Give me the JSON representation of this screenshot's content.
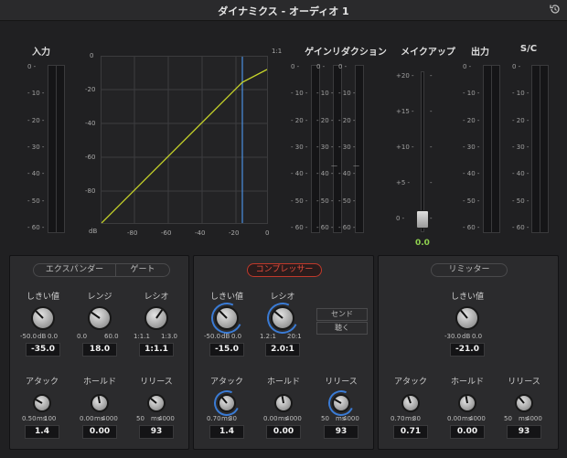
{
  "window": {
    "title": "ダイナミクス - オーディオ 1"
  },
  "headers": {
    "input": "入力",
    "gain_reduction": "ゲインリダクション",
    "makeup": "メイクアップ",
    "output": "出力",
    "sidechain": "S/C"
  },
  "meter_ticks": [
    "0",
    "10",
    "20",
    "30",
    "40",
    "50",
    "60"
  ],
  "makeup_ticks": [
    "+20",
    "+15",
    "+10",
    "+5",
    "0"
  ],
  "makeup_value": "0.0",
  "graph": {
    "ratio_label": "1:1",
    "y_ticks": [
      "0",
      "-20",
      "-40",
      "-60",
      "-80"
    ],
    "x_ticks": [
      "dB",
      "-80",
      "-60",
      "-40",
      "-20",
      "0"
    ]
  },
  "panels": {
    "expander": {
      "tab1": "エクスパンダー",
      "tab2": "ゲート",
      "threshold": {
        "label": "しきい値",
        "min": "-50.0",
        "unit": "dB",
        "max": "0.0",
        "value": "-35.0"
      },
      "range": {
        "label": "レンジ",
        "min": "0.0",
        "max": "60.0",
        "value": "18.0"
      },
      "ratio": {
        "label": "レシオ",
        "min": "1:1.1",
        "max": "1:3.0",
        "value": "1:1.1"
      },
      "attack": {
        "label": "アタック",
        "min": "0.50",
        "unit": "ms",
        "max": "100",
        "value": "1.4"
      },
      "hold": {
        "label": "ホールド",
        "min": "0.00",
        "unit": "ms",
        "max": "4000",
        "value": "0.00"
      },
      "release": {
        "label": "リリース",
        "min": "50",
        "unit": "ms",
        "max": "4000",
        "value": "93"
      }
    },
    "compressor": {
      "title": "コンプレッサー",
      "threshold": {
        "label": "しきい値",
        "min": "-50.0",
        "unit": "dB",
        "max": "0.0",
        "value": "-15.0"
      },
      "ratio": {
        "label": "レシオ",
        "min": "1.2:1",
        "max": "20:1",
        "value": "2.0:1"
      },
      "send": "センド",
      "listen": "聴く",
      "attack": {
        "label": "アタック",
        "min": "0.70",
        "unit": "ms",
        "max": "30",
        "value": "1.4"
      },
      "hold": {
        "label": "ホールド",
        "min": "0.00",
        "unit": "ms",
        "max": "4000",
        "value": "0.00"
      },
      "release": {
        "label": "リリース",
        "min": "50",
        "unit": "ms",
        "max": "4000",
        "value": "93"
      }
    },
    "limiter": {
      "title": "リミッター",
      "threshold": {
        "label": "しきい値",
        "min": "-30.0",
        "unit": "dB",
        "max": "0.0",
        "value": "-21.0"
      },
      "attack": {
        "label": "アタック",
        "min": "0.70",
        "unit": "ms",
        "max": "30",
        "value": "0.71"
      },
      "hold": {
        "label": "ホールド",
        "min": "0.00",
        "unit": "ms",
        "max": "4000",
        "value": "0.00"
      },
      "release": {
        "label": "リリース",
        "min": "50",
        "unit": "ms",
        "max": "4000",
        "value": "93"
      }
    }
  },
  "colors": {
    "curve": "#c8d62a",
    "threshold_line": "#4a90e2",
    "accent_red": "#e74c3c",
    "value_green": "#8fd14f"
  }
}
